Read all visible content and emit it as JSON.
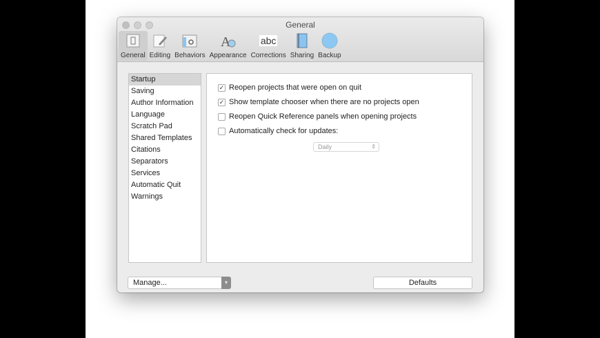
{
  "window": {
    "title": "General"
  },
  "toolbar": [
    {
      "label": "General",
      "icon": "general-icon"
    },
    {
      "label": "Editing",
      "icon": "editing-icon"
    },
    {
      "label": "Behaviors",
      "icon": "behaviors-icon"
    },
    {
      "label": "Appearance",
      "icon": "appearance-icon"
    },
    {
      "label": "Corrections",
      "icon": "corrections-icon",
      "glyph": "abc"
    },
    {
      "label": "Sharing",
      "icon": "sharing-icon"
    },
    {
      "label": "Backup",
      "icon": "backup-icon"
    }
  ],
  "sidebar": [
    "Startup",
    "Saving",
    "Author Information",
    "Language",
    "Scratch Pad",
    "Shared Templates",
    "Citations",
    "Separators",
    "Services",
    "Automatic Quit",
    "Warnings"
  ],
  "options": [
    {
      "label": "Reopen projects that were open on quit",
      "checked": true
    },
    {
      "label": "Show template chooser when there are no projects open",
      "checked": true
    },
    {
      "label": "Reopen Quick Reference panels when opening projects",
      "checked": false
    },
    {
      "label": "Automatically check for updates:",
      "checked": false
    }
  ],
  "update_frequency": "Daily",
  "footer": {
    "manage": "Manage...",
    "defaults": "Defaults"
  }
}
